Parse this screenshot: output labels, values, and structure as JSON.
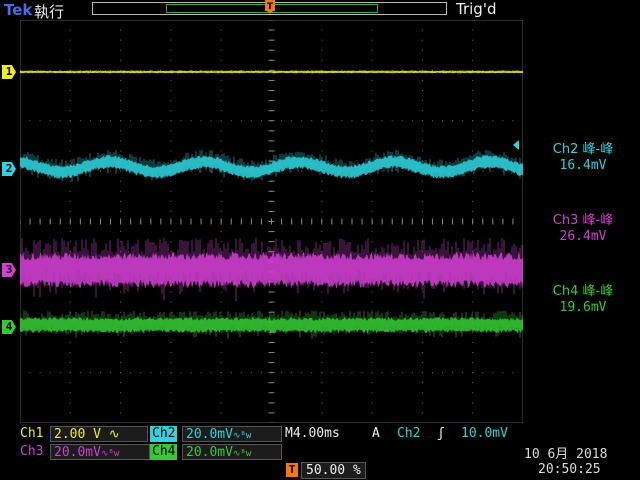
{
  "header": {
    "brand": "Tek",
    "run_state": "執行",
    "trig_status": "Trig'd",
    "trigger_position_marker": "T"
  },
  "channels": [
    {
      "id": "1",
      "color": "#eeee20"
    },
    {
      "id": "2",
      "color": "#2fd2de"
    },
    {
      "id": "3",
      "color": "#d23fd2"
    },
    {
      "id": "4",
      "color": "#35c935"
    }
  ],
  "measurements": [
    {
      "label": "Ch2 峰-峰",
      "value": "16.4mV",
      "color": "#2fd2de"
    },
    {
      "label": "Ch3 峰-峰",
      "value": "26.4mV",
      "color": "#d23fd2"
    },
    {
      "label": "Ch4 峰-峰",
      "value": "19.6mV",
      "color": "#35c935"
    }
  ],
  "bottom": {
    "ch1_label": "Ch1",
    "ch1_scale": "2.00 V",
    "ch2_label": "Ch2",
    "ch2_scale": "20.0mV",
    "ch3_label": "Ch3",
    "ch3_scale": "20.0mV",
    "ch4_label": "Ch4",
    "ch4_scale": "20.0mV",
    "timebase": "M4.00ms",
    "trigger_source_label": "A",
    "trigger_channel": "Ch2",
    "trigger_level": "10.0mV",
    "trigger_position_percent": "50.00 %",
    "date": "10 6月 2018",
    "time": "20:50:25"
  }
}
